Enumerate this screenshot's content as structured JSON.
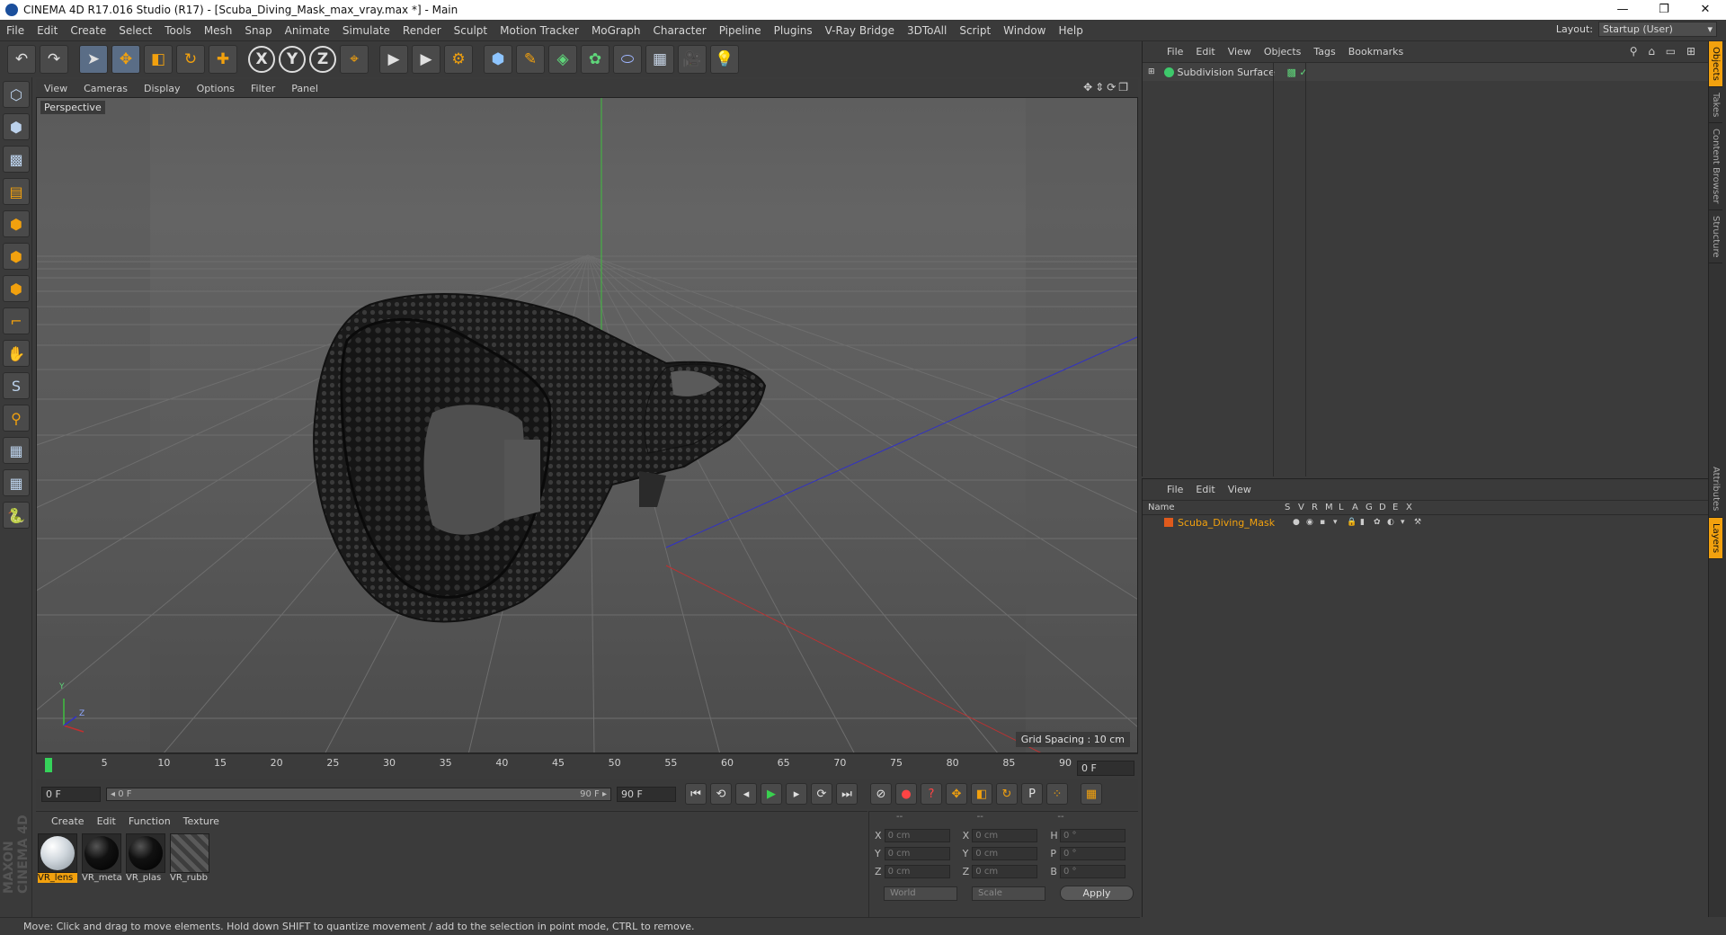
{
  "window": {
    "title": "CINEMA 4D R17.016 Studio (R17) - [Scuba_Diving_Mask_max_vray.max *] - Main",
    "minimize": "—",
    "maximize": "❐",
    "close": "✕"
  },
  "menubar": {
    "items": [
      "File",
      "Edit",
      "Create",
      "Select",
      "Tools",
      "Mesh",
      "Snap",
      "Animate",
      "Simulate",
      "Render",
      "Sculpt",
      "Motion Tracker",
      "MoGraph",
      "Character",
      "Pipeline",
      "Plugins",
      "V-Ray Bridge",
      "3DToAll",
      "Script",
      "Window",
      "Help"
    ],
    "layout_label": "Layout:",
    "layout_value": "Startup (User)"
  },
  "toolbar": {
    "undo": "↶",
    "redo": "↷",
    "select": "➤",
    "move": "✥",
    "scale": "◧",
    "rotate": "↻",
    "live": "✚",
    "x": "X",
    "y": "Y",
    "z": "Z",
    "coord": "⌖",
    "render_view": "▶",
    "render_pic": "▶",
    "render_settings": "⚙",
    "cube": "⬢",
    "pen": "✎",
    "subdiv": "◈",
    "cloner": "✿",
    "deformer": "⬭",
    "floor": "▦",
    "camera": "🎥",
    "light": "💡"
  },
  "leftbar": {
    "icons": [
      "⬡",
      "⬢",
      "▩",
      "▤",
      "⬢",
      "⬢",
      "⬢",
      "⌐",
      "✋",
      "S",
      "⚲",
      "▦",
      "▦",
      "🐍"
    ]
  },
  "viewport": {
    "menu": [
      "View",
      "Cameras",
      "Display",
      "Options",
      "Filter",
      "Panel"
    ],
    "nav_icons": "✥⇕⟳❐",
    "label": "Perspective",
    "grid_spacing": "Grid Spacing : 10 cm",
    "axis_y": "Y",
    "axis_z": "Z"
  },
  "timeline": {
    "ticks": [
      "0",
      "5",
      "10",
      "15",
      "20",
      "25",
      "30",
      "35",
      "40",
      "45",
      "50",
      "55",
      "60",
      "65",
      "70",
      "75",
      "80",
      "85",
      "90"
    ],
    "current_frame": "0 F"
  },
  "transport": {
    "start_field": "0 F",
    "range_start": "◂ 0 F",
    "range_end": "90 F ▸",
    "end_field": "90 F",
    "buttons": [
      "⏮",
      "⟲",
      "◂",
      "▶",
      "▸",
      "⟳",
      "⏭"
    ],
    "key_buttons": [
      "⊘",
      "●",
      "?",
      "✥",
      "◧",
      "↻",
      "P",
      "⁘",
      "▦"
    ]
  },
  "materials": {
    "menu": [
      "Create",
      "Edit",
      "Function",
      "Texture"
    ],
    "items": [
      {
        "name": "VR_lens",
        "kind": "lens"
      },
      {
        "name": "VR_meta",
        "kind": "dark"
      },
      {
        "name": "VR_plas",
        "kind": "dark"
      },
      {
        "name": "VR_rubb",
        "kind": "rubber"
      }
    ]
  },
  "coordinates": {
    "headers": [
      "--",
      "--",
      "--"
    ],
    "rows": [
      {
        "a1": "X",
        "v1": "0 cm",
        "a2": "X",
        "v2": "0 cm",
        "a3": "H",
        "v3": "0 °"
      },
      {
        "a1": "Y",
        "v1": "0 cm",
        "a2": "Y",
        "v2": "0 cm",
        "a3": "P",
        "v3": "0 °"
      },
      {
        "a1": "Z",
        "v1": "0 cm",
        "a2": "Z",
        "v2": "0 cm",
        "a3": "B",
        "v3": "0 °"
      }
    ],
    "space": "World",
    "mode": "Scale",
    "apply": "Apply"
  },
  "status": "Move: Click and drag to move elements. Hold down SHIFT to quantize movement / add to the selection in point mode, CTRL to remove.",
  "objects": {
    "menu": [
      "File",
      "Edit",
      "View",
      "Objects",
      "Tags",
      "Bookmarks"
    ],
    "icons": "⚲ ⌂ ▭ ⊞",
    "items": [
      {
        "name": "Subdivision Surface",
        "tags": "▩ ✓"
      }
    ]
  },
  "layers": {
    "menu": [
      "File",
      "Edit",
      "View"
    ],
    "columns": [
      "Name",
      "S",
      "V",
      "R",
      "M",
      "L",
      "A",
      "G",
      "D",
      "E",
      "X"
    ],
    "rows": [
      {
        "name": "Scuba_Diving_Mask",
        "flags": [
          "●",
          "◉",
          "▪",
          "▾",
          "🔒",
          "▮",
          "✿",
          "◐",
          "▾",
          "⚒"
        ]
      }
    ]
  },
  "side_tabs": [
    "Objects",
    "Takes",
    "Content Browser",
    "Structure",
    "Attributes",
    "Layers"
  ],
  "brand": "MAXON CINEMA 4D"
}
